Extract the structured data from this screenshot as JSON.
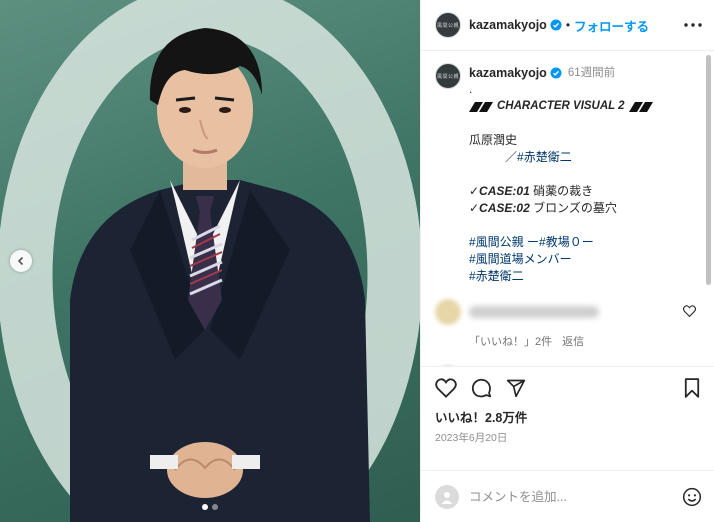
{
  "header": {
    "account_badge": "風間公親",
    "username": "kazamakyojo",
    "separator": "•",
    "follow_label": "フォローする"
  },
  "caption": {
    "username": "kazamakyojo",
    "time": "61週間前",
    "lines": [
      ".",
      "CHARACTER VISUAL 2",
      "",
      "瓜原潤史",
      "　　　／#赤楚衛二",
      "",
      "✓CASE:01 硝薬の裁き",
      "✓CASE:02 ブロンズの墓穴",
      "",
      "#風間公親 ー#教場０ー",
      "#風間道場メンバー",
      "#赤楚衛二"
    ]
  },
  "caption_parts": {
    "dot": ".",
    "visual_title": "CHARACTER VISUAL 2",
    "name": "瓜原潤史",
    "actor_prefix": "／",
    "actor_tag": "#赤楚衛二",
    "case1_label": "✓CASE:01",
    "case1_title": "硝薬の裁き",
    "case2_label": "✓CASE:02",
    "case2_title": "ブロンズの墓穴",
    "tag1": "#風間公親",
    "tag1_suffix": " ー#教場０ー",
    "tag2": "#風間道場メンバー",
    "tag3": "#赤楚衛二"
  },
  "comment1": {
    "likes": "「いいね！」2件",
    "reply_label": "返信"
  },
  "post": {
    "likes": "いいね！2.8万件",
    "date": "2023年6月20日"
  },
  "comment_input": {
    "placeholder": "コメントを追加..."
  },
  "icons": {
    "verified": "verified-badge-icon",
    "more": "more-horizontal-icon",
    "like": "heart-icon",
    "comment": "comment-icon",
    "share": "send-icon",
    "save": "bookmark-icon",
    "emoji": "emoji-icon",
    "prev": "chevron-left-icon"
  },
  "colors": {
    "accent": "#0095f6",
    "hashtag": "#00376b",
    "secondary_text": "#8e8e8e",
    "background_photo": "#3f7565"
  },
  "carousel": {
    "slide_count": 2,
    "active_index": 0
  }
}
